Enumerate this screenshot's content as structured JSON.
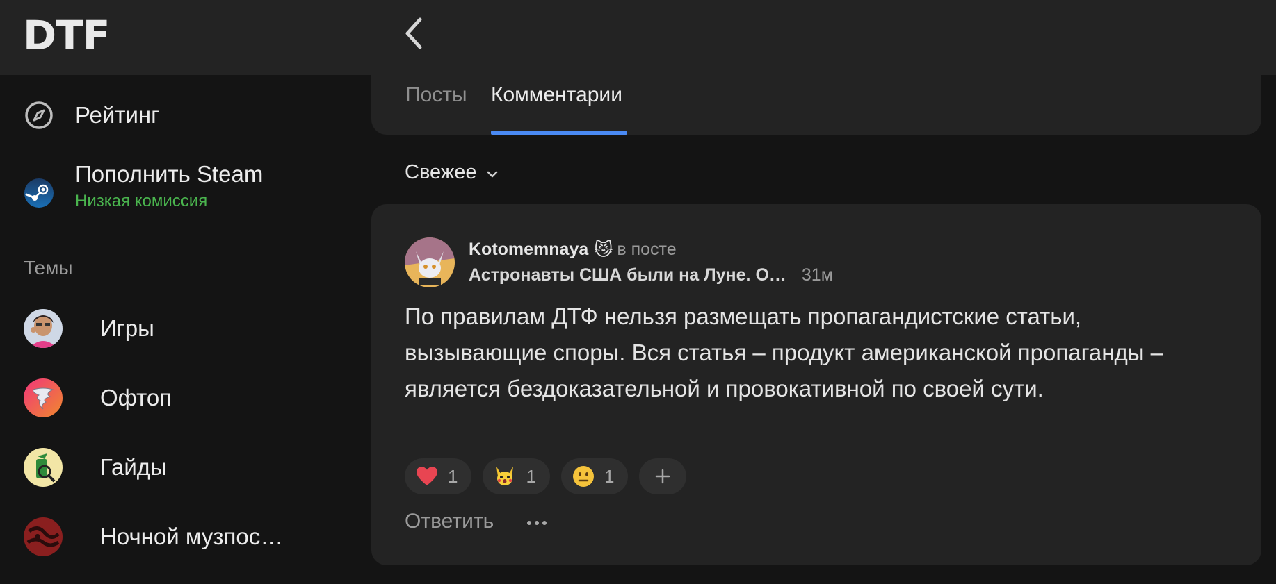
{
  "header": {
    "logo": "DTF",
    "back_icon": "chevron-left-icon"
  },
  "sidebar": {
    "items": [
      {
        "label": "Рейтинг",
        "icon": "compass-icon"
      },
      {
        "label": "Пополнить Steam",
        "sublabel": "Низкая комиссия",
        "icon": "steam-icon"
      }
    ],
    "topics_title": "Темы",
    "topics": [
      {
        "label": "Игры"
      },
      {
        "label": "Офтоп"
      },
      {
        "label": "Гайды"
      },
      {
        "label": "Ночной музпос…"
      }
    ]
  },
  "tabs": {
    "posts": "Посты",
    "comments": "Комментарии",
    "active": "comments"
  },
  "sort": {
    "label": "Свежее"
  },
  "comment": {
    "author": "Kotomemnaya",
    "author_emoji": "😼",
    "in_post": "в посте",
    "post_title": "Астронавты США были на Луне. О…",
    "time": "31м",
    "text": "По правилам ДТФ нельзя размещать пропагандистские статьи, вызывающие споры. Вся статья – продукт американской пропаганды – является бездоказательной и провокативной по своей сути.",
    "reactions": [
      {
        "emoji": "❤️",
        "count": "1",
        "icon": "heart-icon"
      },
      {
        "emoji": "🙀",
        "count": "1",
        "icon": "pikachu-surprised-icon"
      },
      {
        "emoji": "😐",
        "count": "1",
        "icon": "neutral-face-icon"
      }
    ],
    "add_reaction": "+",
    "reply_label": "Ответить",
    "more_icon": "ellipsis-icon"
  },
  "colors": {
    "accent": "#4a8af4",
    "green": "#4ab44e",
    "background": "#141414",
    "card": "#232323"
  }
}
